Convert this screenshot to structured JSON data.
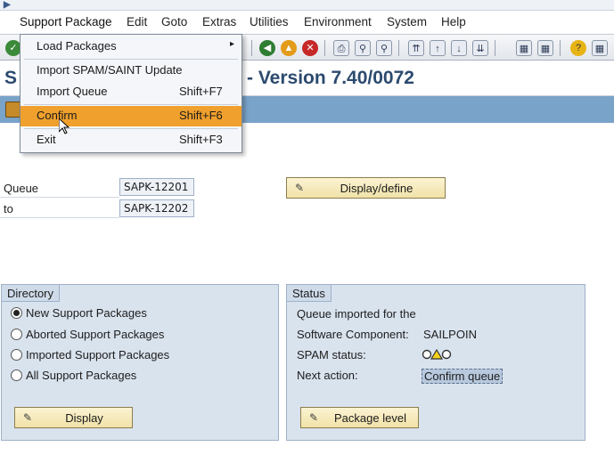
{
  "menubar": {
    "items": [
      "Support Package",
      "Edit",
      "Goto",
      "Extras",
      "Utilities",
      "Environment",
      "System",
      "Help"
    ]
  },
  "dropdown": {
    "items": [
      {
        "label": "Load Packages",
        "shortcut": "",
        "submenu": true
      },
      {
        "label": "Import SPAM/SAINT Update",
        "shortcut": ""
      },
      {
        "label": "Import Queue",
        "shortcut": "Shift+F7"
      },
      {
        "label": "Confirm",
        "shortcut": "Shift+F6",
        "highlighted": true
      },
      {
        "label": "Exit",
        "shortcut": "Shift+F3"
      }
    ]
  },
  "title": {
    "left": "S",
    "right": "r - Version 7.40/0072"
  },
  "queue": {
    "queue_label": "Queue",
    "queue_value": "SAPK-12201",
    "to_label": "to",
    "to_value": "SAPK-12202",
    "display_define_label": "Display/define"
  },
  "directory": {
    "title": "Directory",
    "options": [
      {
        "label": "New Support Packages",
        "selected": true
      },
      {
        "label": "Aborted Support Packages",
        "selected": false
      },
      {
        "label": "Imported Support Packages",
        "selected": false
      },
      {
        "label": "All Support Packages",
        "selected": false
      }
    ],
    "display_button": "Display"
  },
  "status": {
    "title": "Status",
    "line1": "Queue imported for the",
    "component_label": "Software Component:",
    "component_value": "SAILPOIN",
    "spam_label": "SPAM status:",
    "spam_icon": "traffic-light-yellow-icon",
    "next_label": "Next action:",
    "next_value": "Confirm queue",
    "package_level_button": "Package level"
  },
  "colors": {
    "accent_highlight": "#f0a02c",
    "app_toolbar": "#7aa3c9",
    "title_text": "#2c4a6e",
    "group_bg": "#d9e3ee"
  }
}
